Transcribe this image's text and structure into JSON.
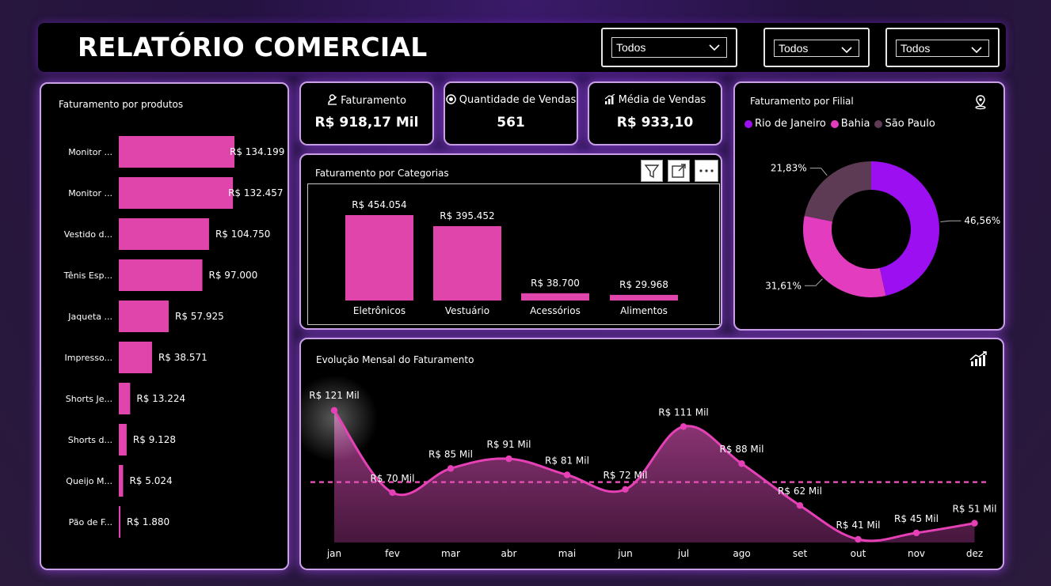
{
  "header": {
    "title": "RELATÓRIO COMERCIAL",
    "filters": [
      {
        "value": "Todos"
      },
      {
        "value": "Todos"
      },
      {
        "value": "Todos"
      }
    ]
  },
  "colors": {
    "bar": "#df45aa",
    "accent_purple": "#9b0ff1",
    "accent_pink": "#e33cbf",
    "accent_mauve": "#5e3b54",
    "panel_border": "#c9a0e6"
  },
  "kpis": [
    {
      "label": "Faturamento",
      "value": "R$ 918,17 Mil",
      "icon": "money-icon"
    },
    {
      "label": "Quantidade de Vendas",
      "value": "561",
      "icon": "target-icon"
    },
    {
      "label": "Média de Vendas",
      "value": "R$ 933,10",
      "icon": "bar-growth-icon"
    }
  ],
  "products_panel": {
    "title": "Faturamento por produtos"
  },
  "categories_panel": {
    "title": "Faturamento por Categorias"
  },
  "branch_panel": {
    "title": "Faturamento por Filial"
  },
  "monthly_panel": {
    "title": "Evolução Mensal do Faturamento"
  },
  "chart_data": [
    {
      "type": "bar",
      "orientation": "horizontal",
      "title": "Faturamento por produtos",
      "categories": [
        "Monitor ...",
        "Monitor ...",
        "Vestido d...",
        "Tênis Esp...",
        "Jaqueta ...",
        "Impresso...",
        "Shorts Je...",
        "Shorts d...",
        "Queijo M...",
        "Pão de F..."
      ],
      "values": [
        134199,
        132457,
        104750,
        97000,
        57925,
        38571,
        13224,
        9128,
        5024,
        1880
      ],
      "labels": [
        "R$ 134.199",
        "R$ 132.457",
        "R$ 104.750",
        "R$ 97.000",
        "R$ 57.925",
        "R$ 38.571",
        "R$ 13.224",
        "R$ 9.128",
        "R$ 5.024",
        "R$ 1.880"
      ]
    },
    {
      "type": "bar",
      "title": "Faturamento por Categorias",
      "categories": [
        "Eletrônicos",
        "Vestuário",
        "Acessórios",
        "Alimentos"
      ],
      "values": [
        454054,
        395452,
        38700,
        29968
      ],
      "labels": [
        "R$ 454.054",
        "R$ 395.452",
        "R$ 38.700",
        "R$ 29.968"
      ]
    },
    {
      "type": "pie",
      "variant": "donut",
      "title": "Faturamento por Filial",
      "categories": [
        "Rio de Janeiro",
        "Bahia",
        "São Paulo"
      ],
      "values": [
        46.56,
        31.61,
        21.83
      ],
      "labels": [
        "46,56%",
        "31,61%",
        "21,83%"
      ],
      "colors": [
        "#9b0ff1",
        "#e33cbf",
        "#5e3b54"
      ],
      "legend": "top-left"
    },
    {
      "type": "area",
      "title": "Evolução Mensal do Faturamento",
      "categories": [
        "jan",
        "fev",
        "mar",
        "abr",
        "mai",
        "jun",
        "jul",
        "ago",
        "set",
        "out",
        "nov",
        "dez"
      ],
      "values": [
        121,
        70,
        85,
        91,
        81,
        72,
        111,
        88,
        62,
        41,
        45,
        51
      ],
      "labels": [
        "R$ 121 Mil",
        "R$ 70 Mil",
        "R$ 85 Mil",
        "R$ 91 Mil",
        "R$ 81 Mil",
        "R$ 72 Mil",
        "R$ 111 Mil",
        "R$ 88 Mil",
        "R$ 62 Mil",
        "R$ 41 Mil",
        "R$ 45 Mil",
        "R$ 51 Mil"
      ],
      "reference_line": "average"
    }
  ]
}
